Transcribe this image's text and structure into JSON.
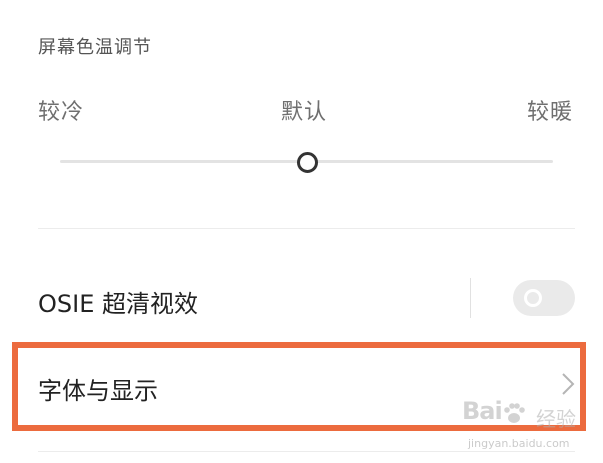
{
  "color_temperature": {
    "title": "屏幕色温调节",
    "label_cold": "较冷",
    "label_default": "默认",
    "label_warm": "较暖",
    "slider_value_percent": 50
  },
  "osie": {
    "label": "OSIE 超清视效",
    "toggle_on": false
  },
  "font_display": {
    "label": "字体与显示",
    "icon": "chevron-right-icon"
  },
  "highlight_color": "#ec6b3e",
  "watermark": {
    "logo": "Bai",
    "label": "经验",
    "url": "jingyan.baidu.com"
  }
}
